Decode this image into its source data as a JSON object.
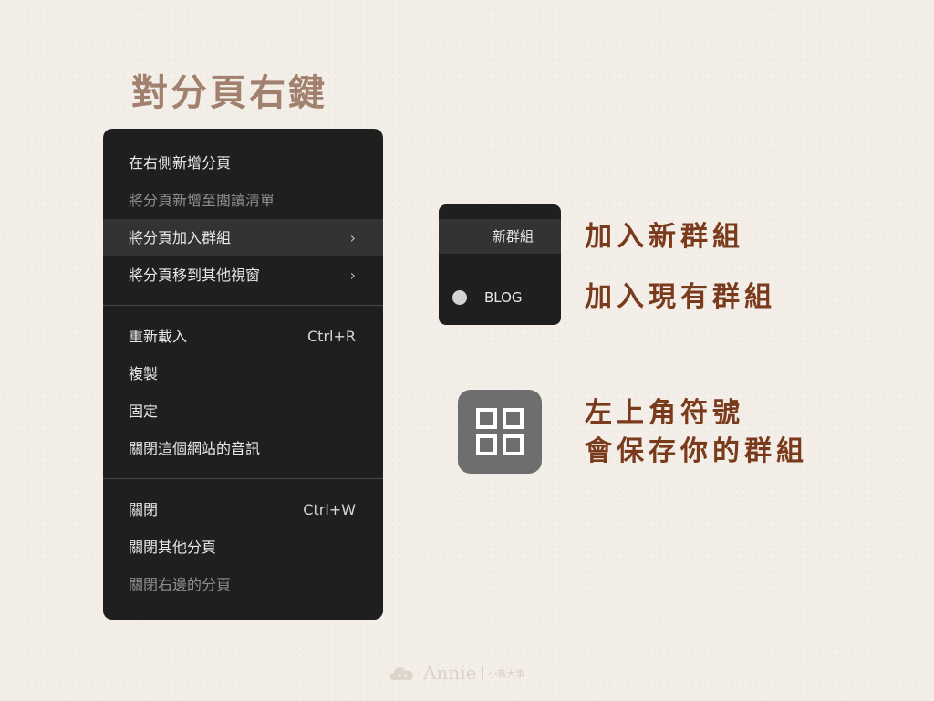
{
  "page_title": "對分頁右鍵",
  "context_menu": {
    "items": [
      {
        "label": "在右側新增分頁",
        "shortcut": "",
        "submenu": false,
        "disabled": false
      },
      {
        "label": "將分頁新增至閱讀清單",
        "shortcut": "",
        "submenu": false,
        "disabled": true
      },
      {
        "label": "將分頁加入群組",
        "shortcut": "",
        "submenu": true,
        "disabled": false,
        "highlighted": true
      },
      {
        "label": "將分頁移到其他視窗",
        "shortcut": "",
        "submenu": true,
        "disabled": false
      },
      {
        "label": "重新載入",
        "shortcut": "Ctrl+R",
        "submenu": false,
        "disabled": false
      },
      {
        "label": "複製",
        "shortcut": "",
        "submenu": false,
        "disabled": false
      },
      {
        "label": "固定",
        "shortcut": "",
        "submenu": false,
        "disabled": false
      },
      {
        "label": "關閉這個網站的音訊",
        "shortcut": "",
        "submenu": false,
        "disabled": false
      },
      {
        "label": "關閉",
        "shortcut": "Ctrl+W",
        "submenu": false,
        "disabled": false
      },
      {
        "label": "關閉其他分頁",
        "shortcut": "",
        "submenu": false,
        "disabled": false
      },
      {
        "label": "關閉右邊的分頁",
        "shortcut": "",
        "submenu": false,
        "disabled": true
      }
    ],
    "chevron": "›"
  },
  "group_submenu": {
    "new_group": "新群組",
    "existing_group": "BLOG"
  },
  "annotations": {
    "add_new_group": "加入新群組",
    "add_existing_group": "加入現有群組",
    "symbol_line1": "左上角符號",
    "symbol_line2": "會保存你的群組"
  },
  "icons": {
    "group_symbol": "grid-four-squares-icon",
    "group_color_dot": "circle-dot-icon",
    "submenu_arrow": "chevron-right-icon"
  },
  "watermark": {
    "name": "Annie",
    "sub": "小薇大事"
  },
  "colors": {
    "background": "#f3efe8",
    "menu_bg": "#1f1f1f",
    "menu_highlight": "#333333",
    "title": "#a1806e",
    "annotation": "#7a3a1c",
    "symbol_tile": "#6e6e6e"
  }
}
